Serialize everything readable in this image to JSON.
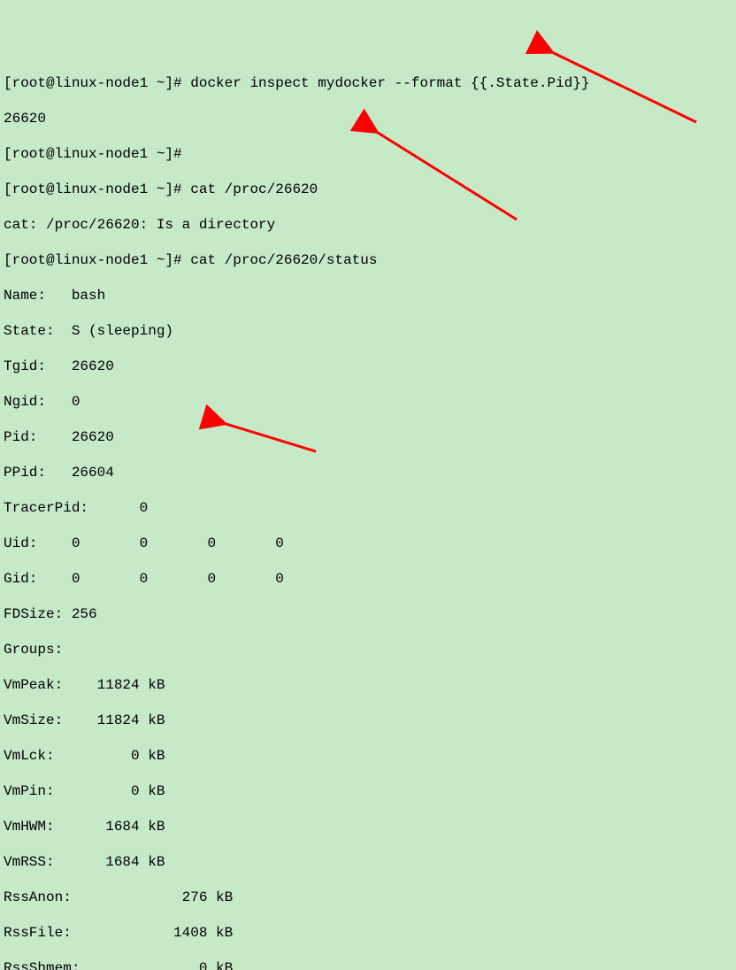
{
  "lines": {
    "l1": "[root@linux-node1 ~]# docker inspect mydocker --format {{.State.Pid}}",
    "l2": "26620",
    "l3": "[root@linux-node1 ~]#",
    "l4": "[root@linux-node1 ~]# cat /proc/26620",
    "l5": "cat: /proc/26620: Is a directory",
    "l6": "[root@linux-node1 ~]# cat /proc/26620/status",
    "l7": "Name:   bash",
    "l8": "State:  S (sleeping)",
    "l9": "Tgid:   26620",
    "l10": "Ngid:   0",
    "l11": "Pid:    26620",
    "l12": "PPid:   26604",
    "l13": "TracerPid:      0",
    "l14": "Uid:    0       0       0       0",
    "l15": "Gid:    0       0       0       0",
    "l16": "FDSize: 256",
    "l17": "Groups:",
    "l18": "VmPeak:    11824 kB",
    "l19": "VmSize:    11824 kB",
    "l20": "VmLck:         0 kB",
    "l21": "VmPin:         0 kB",
    "l22": "VmHWM:      1684 kB",
    "l23": "VmRSS:      1684 kB",
    "l24": "RssAnon:             276 kB",
    "l25": "RssFile:            1408 kB",
    "l26": "RssShmem:              0 kB"
  }
}
